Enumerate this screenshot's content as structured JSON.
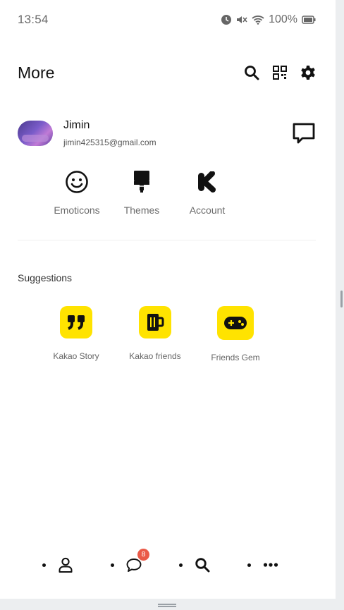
{
  "status_bar": {
    "time": "13:54",
    "battery": "100%"
  },
  "header": {
    "title": "More"
  },
  "profile": {
    "name": "Jimin",
    "email": "jimin425315@gmail.com"
  },
  "quick_links": [
    {
      "label": "Emoticons",
      "icon": "smiley-icon"
    },
    {
      "label": "Themes",
      "icon": "brush-icon"
    },
    {
      "label": "Account",
      "icon": "kakao-k-icon"
    }
  ],
  "suggestions": {
    "title": "Suggestions",
    "items": [
      {
        "label": "Kakao Story",
        "icon": "quote-icon"
      },
      {
        "label": "Kakao friends",
        "icon": "mug-icon"
      },
      {
        "label": "Friends Gem",
        "icon": "gamepad-icon"
      }
    ]
  },
  "bottom_nav": {
    "badge": "8",
    "items": [
      "profile",
      "chats",
      "search",
      "more"
    ]
  },
  "colors": {
    "accent_yellow": "#FFE300",
    "badge_red": "#EA5A48"
  }
}
